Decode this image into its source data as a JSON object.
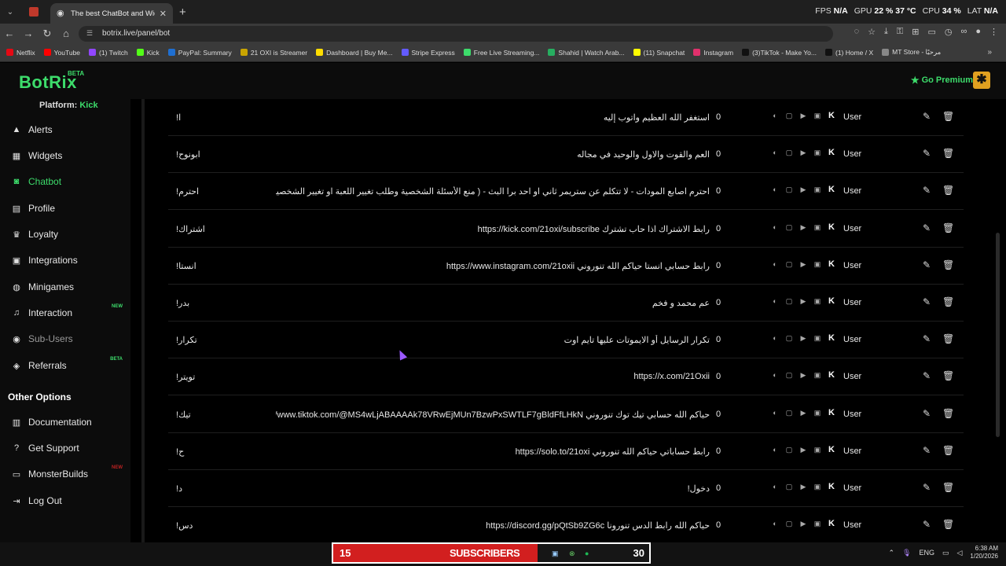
{
  "browser": {
    "tab_title": "The best ChatBot and Widgets",
    "url": "botrix.live/panel/bot",
    "perf": {
      "fps_label": "FPS",
      "fps": "N/A",
      "gpu_label": "GPU",
      "gpu": "22 %",
      "gpu_temp": "37 °C",
      "cpu_label": "CPU",
      "cpu": "34 %",
      "lat_label": "LAT",
      "lat": "N/A"
    },
    "bookmarks": [
      {
        "label": "Netflix",
        "color": "#e50914"
      },
      {
        "label": "YouTube",
        "color": "#ff0000"
      },
      {
        "label": "(1) Twitch",
        "color": "#9146ff"
      },
      {
        "label": "Kick",
        "color": "#53fc18"
      },
      {
        "label": "PayPal: Summary",
        "color": "#1f6fd1"
      },
      {
        "label": "21 OXI is Streamer",
        "color": "#c9a400"
      },
      {
        "label": "Dashboard | Buy Me...",
        "color": "#ffdd00"
      },
      {
        "label": "Stripe Express",
        "color": "#635bff"
      },
      {
        "label": "Free Live Streaming...",
        "color": "#3ddc6b"
      },
      {
        "label": "Shahid | Watch Arab...",
        "color": "#27ae60"
      },
      {
        "label": "(11) Snapchat",
        "color": "#fffc00"
      },
      {
        "label": "Instagram",
        "color": "#e1306c"
      },
      {
        "label": "(3)TikTok - Make Yo...",
        "color": "#111111"
      },
      {
        "label": "(1) Home / X",
        "color": "#111111"
      },
      {
        "label": "MT Store - مرحبًا",
        "color": "#888888"
      }
    ]
  },
  "app": {
    "logo": "BotRix",
    "beta": "BETA",
    "premium": "Go Premium",
    "platform_label": "Platform:",
    "platform_value": "Kick",
    "nav": [
      {
        "label": "Alerts",
        "icon": "warning-icon"
      },
      {
        "label": "Widgets",
        "icon": "grid-icon"
      },
      {
        "label": "Chatbot",
        "icon": "robot-icon"
      },
      {
        "label": "Profile",
        "icon": "id-card-icon"
      },
      {
        "label": "Loyalty",
        "icon": "trophy-icon"
      },
      {
        "label": "Integrations",
        "icon": "plug-icon"
      },
      {
        "label": "Minigames",
        "icon": "gamepad-icon"
      },
      {
        "label": "Interaction",
        "icon": "music-icon",
        "badge": "NEW"
      },
      {
        "label": "Sub-Users",
        "icon": "users-icon"
      },
      {
        "label": "Referrals",
        "icon": "people-icon",
        "badge": "BETA"
      }
    ],
    "other_options_label": "Other Options",
    "other": [
      {
        "label": "Documentation",
        "icon": "book-icon"
      },
      {
        "label": "Get Support",
        "icon": "help-icon"
      },
      {
        "label": "MonsterBuilds",
        "icon": "monitor-icon",
        "badge": "NEW"
      },
      {
        "label": "Log Out",
        "icon": "logout-icon"
      }
    ]
  },
  "commands": [
    {
      "cmd": "!ا",
      "response": "استغفر الله العظيم واتوب إليه",
      "uses": "0",
      "perm": "User"
    },
    {
      "cmd": "!ابونوح",
      "response": "العم والقوت والاول والوحيد في مجاله",
      "uses": "0",
      "perm": "User"
    },
    {
      "cmd": "!احترم",
      "response": "احترم اصابع المودات - لا تتكلم عن ستريمر ثاني او احد برا البث - ( منع الأسئلة الشخصية وطلب تغيير اللعبة او تغيير الشخصية والاسئلة الشخصية",
      "uses": "0",
      "perm": "User"
    },
    {
      "cmd": "!اشتراك",
      "response": "رابط الاشتراك اذا حاب تشترك https://kick.com/21oxi/subscribe",
      "uses": "0",
      "perm": "User"
    },
    {
      "cmd": "!انستا",
      "response": "رابط حسابي انستا حياكم الله تنوروني https://www.instagram.com/21oxii",
      "uses": "0",
      "perm": "User"
    },
    {
      "cmd": "!بدر",
      "response": "عم محمد و فخم",
      "uses": "0",
      "perm": "User"
    },
    {
      "cmd": "!تكرار",
      "response": "تكرار الرسايل أو الايموتات عليها تايم اوت",
      "uses": "0",
      "perm": "User"
    },
    {
      "cmd": "!تويتر",
      "response": "https://x.com/21Oxii",
      "uses": "0",
      "perm": "User"
    },
    {
      "cmd": "!تيك",
      "response": "حياكم الله حسابي تيك توك تنوروني https://www.tiktok.com/@MS4wLjABAAAAk78VRwEjMUn7BzwPxSWTLF7gBldFfLHkN",
      "uses": "0",
      "perm": "User"
    },
    {
      "cmd": "!ح",
      "response": "رابط حساباتي حياكم الله تنوروني https://solo.to/21oxi",
      "uses": "0",
      "perm": "User"
    },
    {
      "cmd": "!د",
      "response": "دخول!",
      "uses": "0",
      "perm": "User"
    },
    {
      "cmd": "!دس",
      "response": "حياكم الله رابط الدس تنورونا https://discord.gg/pQtSb9ZG6c",
      "uses": "0",
      "perm": "User"
    }
  ],
  "taskbar": {
    "sub_count_left": "15",
    "sub_label": "SUBSCRIBERS",
    "sub_count_right": "30",
    "lang": "ENG",
    "time": "6:38 AM",
    "date": "1/20/2026"
  }
}
